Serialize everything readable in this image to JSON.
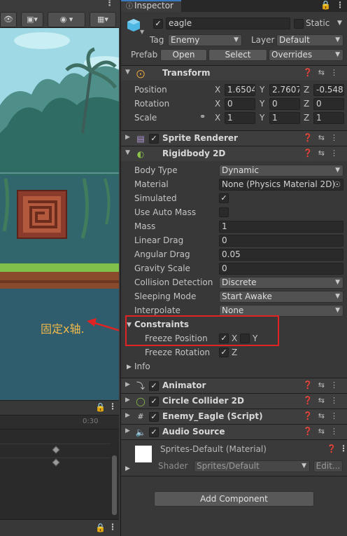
{
  "inspector": {
    "tab_label": "Inspector",
    "object_name": "eagle",
    "static_label": "Static",
    "tag_label": "Tag",
    "tag_value": "Enemy",
    "layer_label": "Layer",
    "layer_value": "Default",
    "prefab_label": "Prefab",
    "open_label": "Open",
    "select_label": "Select",
    "overrides_label": "Overrides"
  },
  "transform": {
    "title": "Transform",
    "position_label": "Position",
    "rotation_label": "Rotation",
    "scale_label": "Scale",
    "axis_x": "X",
    "axis_y": "Y",
    "axis_z": "Z",
    "position": {
      "x": "1.6504",
      "y": "2.7607",
      "z": "-0.548"
    },
    "rotation": {
      "x": "0",
      "y": "0",
      "z": "0"
    },
    "scale": {
      "x": "1",
      "y": "1",
      "z": "1"
    }
  },
  "sprite_renderer": {
    "title": "Sprite Renderer"
  },
  "rigidbody": {
    "title": "Rigidbody 2D",
    "body_type_label": "Body Type",
    "body_type_value": "Dynamic",
    "material_label": "Material",
    "material_value": "None (Physics Material 2D)",
    "simulated_label": "Simulated",
    "use_auto_mass_label": "Use Auto Mass",
    "mass_label": "Mass",
    "mass_value": "1",
    "linear_drag_label": "Linear Drag",
    "linear_drag_value": "0",
    "angular_drag_label": "Angular Drag",
    "angular_drag_value": "0.05",
    "gravity_scale_label": "Gravity Scale",
    "gravity_scale_value": "0",
    "collision_detection_label": "Collision Detection",
    "collision_detection_value": "Discrete",
    "sleeping_mode_label": "Sleeping Mode",
    "sleeping_mode_value": "Start Awake",
    "interpolate_label": "Interpolate",
    "interpolate_value": "None",
    "constraints_label": "Constraints",
    "freeze_position_label": "Freeze Position",
    "freeze_rotation_label": "Freeze Rotation",
    "fx_label": "X",
    "fy_label": "Y",
    "fz_label": "Z",
    "info_label": "Info"
  },
  "components": {
    "animator": "Animator",
    "circle_collider": "Circle Collider 2D",
    "enemy_eagle": "Enemy_Eagle (Script)",
    "audio_source": "Audio Source"
  },
  "material_preview": {
    "name": "Sprites-Default (Material)",
    "shader_label": "Shader",
    "shader_value": "Sprites/Default",
    "edit_label": "Edit..."
  },
  "add_component_label": "Add Component",
  "annotation_text": "固定x轴.",
  "timeline": {
    "time_label": "0:30"
  },
  "colors": {
    "accent": "#3a79bb",
    "annotation": "#f2b94a",
    "highlight_box": "#e02424",
    "checkmark": "#e6e6e6"
  }
}
